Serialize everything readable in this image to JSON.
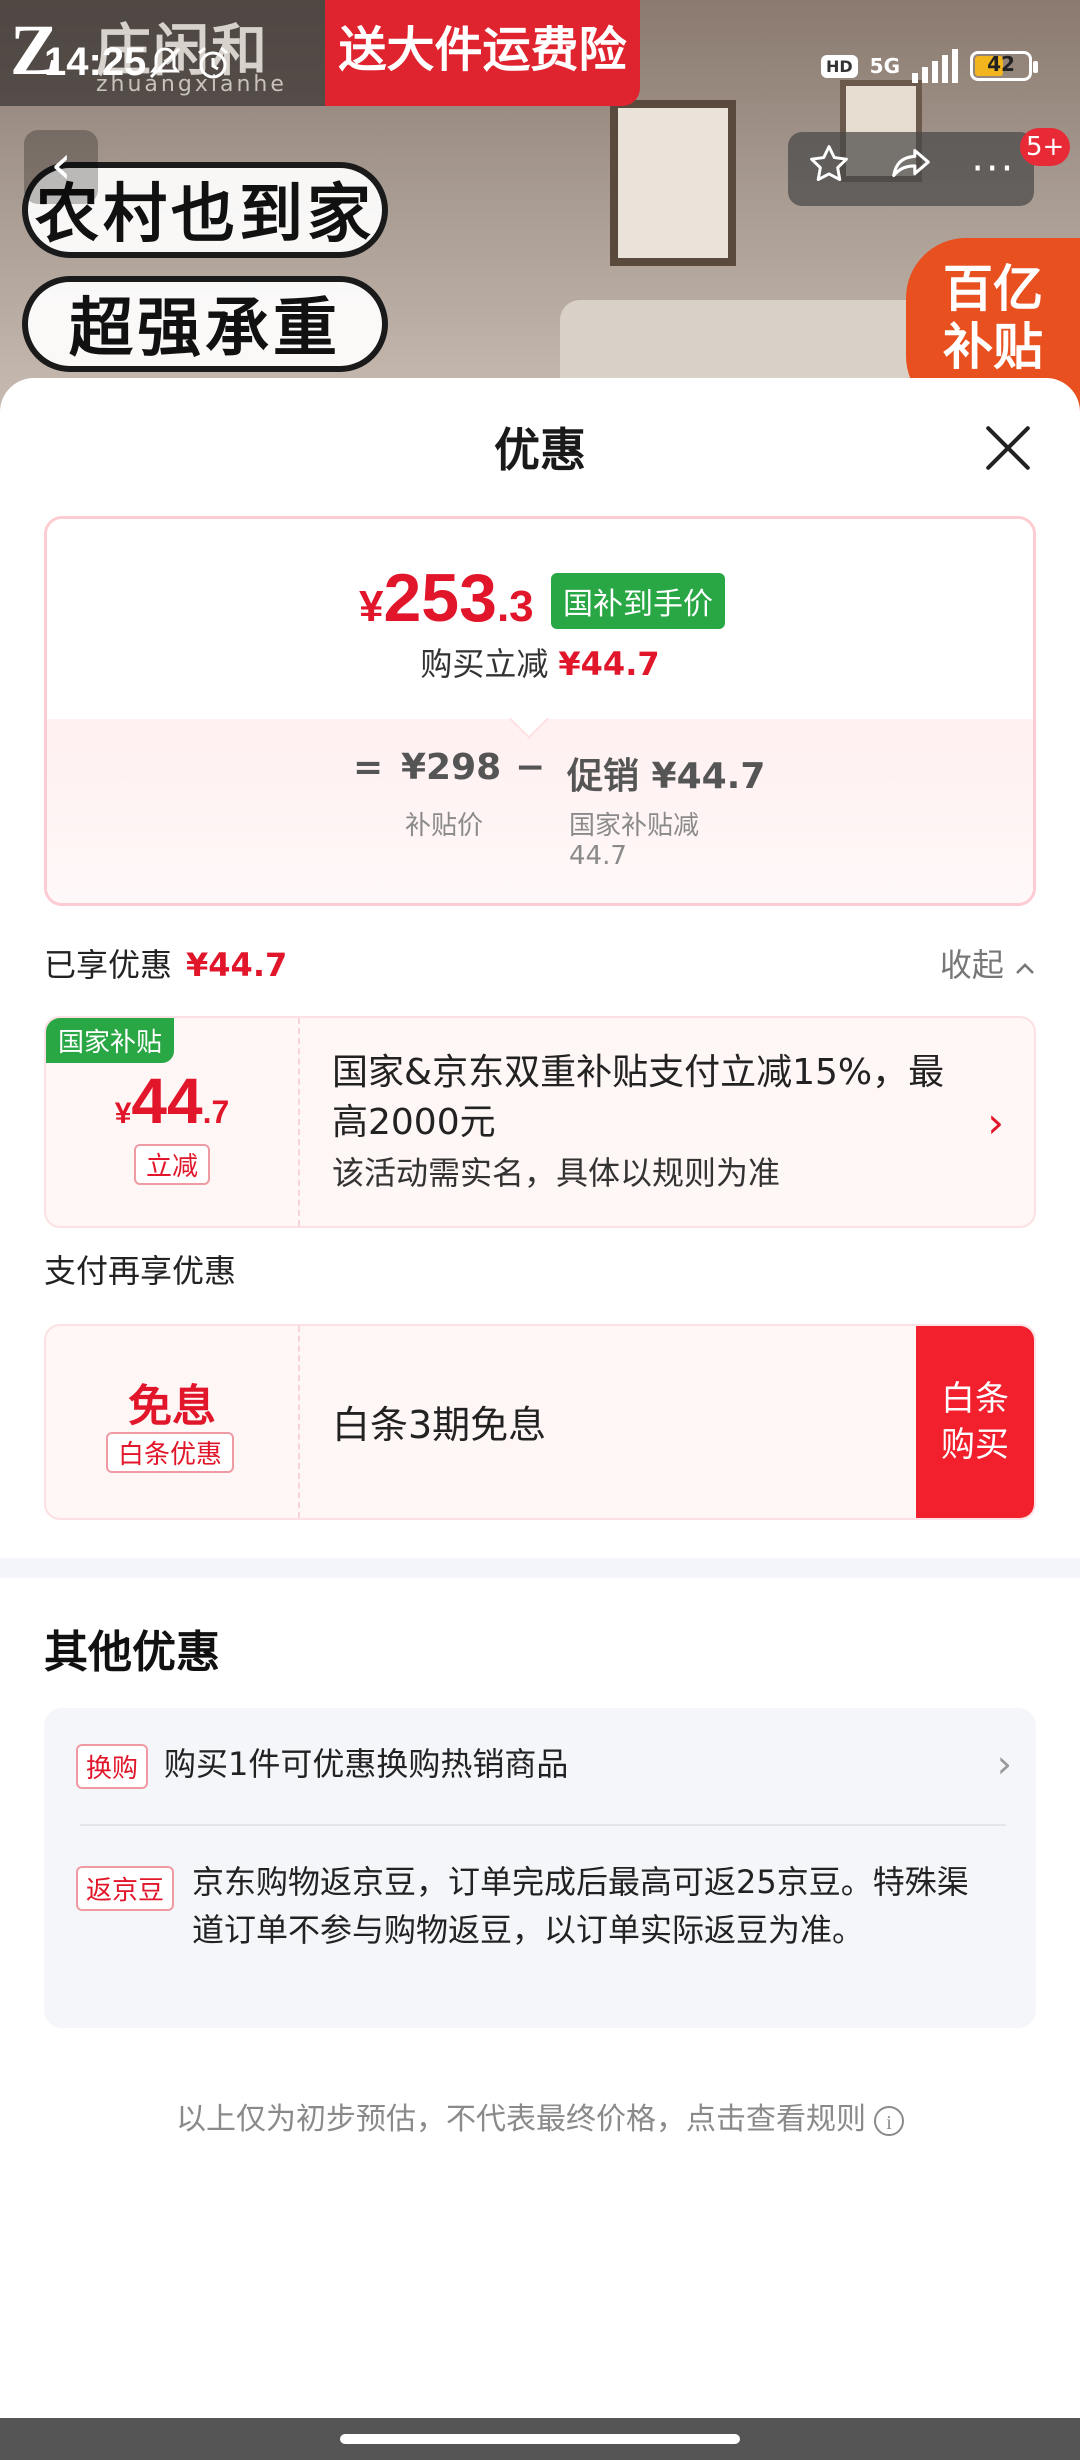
{
  "status_bar": {
    "time": "14:25",
    "hd": "HD",
    "network": "5G",
    "battery": "42"
  },
  "banner": {
    "logo_mark": "Z",
    "logo_text": "庄闲和",
    "logo_sub": "zhuangxianhe",
    "ship_tag": "送大件运费险",
    "tag_1": "农村也到家",
    "tag_2": "超强承重",
    "subsidy_line1": "百亿",
    "subsidy_line2": "补贴"
  },
  "nav": {
    "msg_badge": "5+"
  },
  "sheet": {
    "title": "优惠",
    "price_card": {
      "currency": "¥",
      "price_int": "253",
      "price_dec": ".3",
      "tag": "国补到手价",
      "buy_cut_label": "购买立减",
      "buy_cut_amount": "¥44.7",
      "equals": "=",
      "base_price": "¥298",
      "base_label": "补贴价",
      "minus": "−",
      "promo_label": "促销 ¥44.7",
      "promo_sub_1": "国家补贴减",
      "promo_sub_2": "44.7"
    },
    "enjoyed": {
      "label": "已享优惠",
      "amount": "¥44.7",
      "collapse": "收起"
    },
    "coupon_subsidy": {
      "tag": "国家补贴",
      "currency": "¥",
      "amt_int": "44",
      "amt_dec": ".7",
      "kind": "立减",
      "text": "国家&京东双重补贴支付立减15%，最高2000元",
      "note": "该活动需实名，具体以规则为准"
    },
    "pay_more": {
      "title": "支付再享优惠",
      "big": "免息",
      "tag": "白条优惠",
      "text": "白条3期免息",
      "button": "白条购买"
    },
    "other": {
      "title": "其他优惠",
      "row1_tag": "换购",
      "row1_text": "购买1件可优惠换购热销商品",
      "row2_tag": "返京豆",
      "row2_text": "京东购物返京豆，订单完成后最高可返25京豆。特殊渠道订单不参与购物返豆，以订单实际返豆为准。"
    },
    "footnote": "以上仅为初步预估，不代表最终价格，点击查看规则"
  }
}
